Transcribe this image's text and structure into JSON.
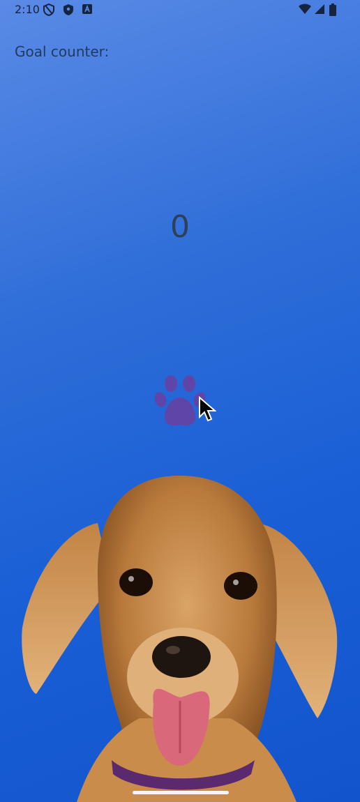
{
  "status_bar": {
    "time": "2:10",
    "icons": [
      "shield-outline-icon",
      "shield-icon",
      "a-icon"
    ],
    "right_icons": [
      "wifi-icon",
      "cellular-icon",
      "battery-icon"
    ]
  },
  "goal": {
    "label": "Goal counter:"
  },
  "counter": {
    "value": "0"
  },
  "paw_button": {
    "icon": "paw-icon",
    "color": "#6b3fa0"
  },
  "background": {
    "sky_color": "#1a5fd6",
    "image": "puppy-image"
  }
}
